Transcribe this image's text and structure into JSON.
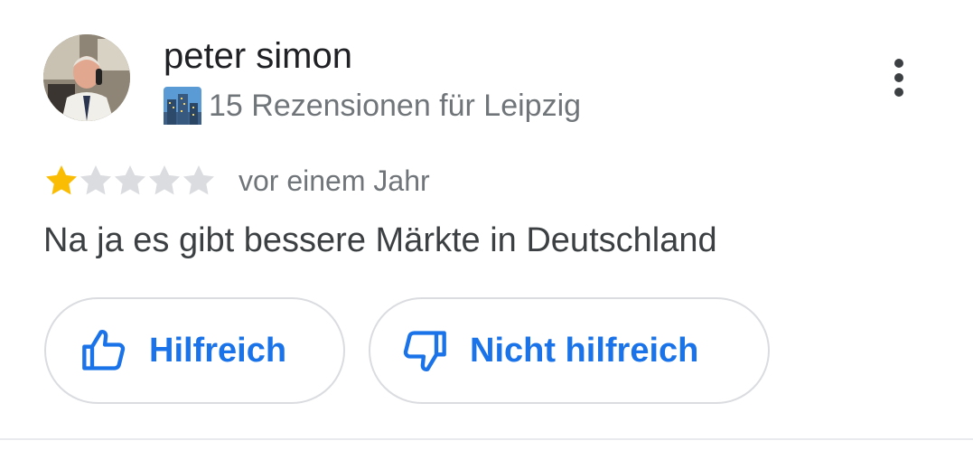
{
  "reviewer": {
    "name": "peter simon",
    "meta": "15 Rezensionen für Leipzig",
    "badge_icon": "cityscape-icon",
    "avatar": "profile-photo"
  },
  "review": {
    "rating": 1,
    "max_rating": 5,
    "date": "vor einem Jahr",
    "text": "Na ja es gibt bessere Märkte in Deutschland"
  },
  "actions": {
    "helpful_label": "Hilfreich",
    "not_helpful_label": "Nicht hilfreich",
    "more_icon": "more-vertical-icon"
  },
  "colors": {
    "accent": "#1a73e8",
    "star_filled": "#fbbc04",
    "star_empty": "#dadce0",
    "text_primary": "#202124",
    "text_secondary": "#70757a",
    "border": "#dadce0"
  }
}
